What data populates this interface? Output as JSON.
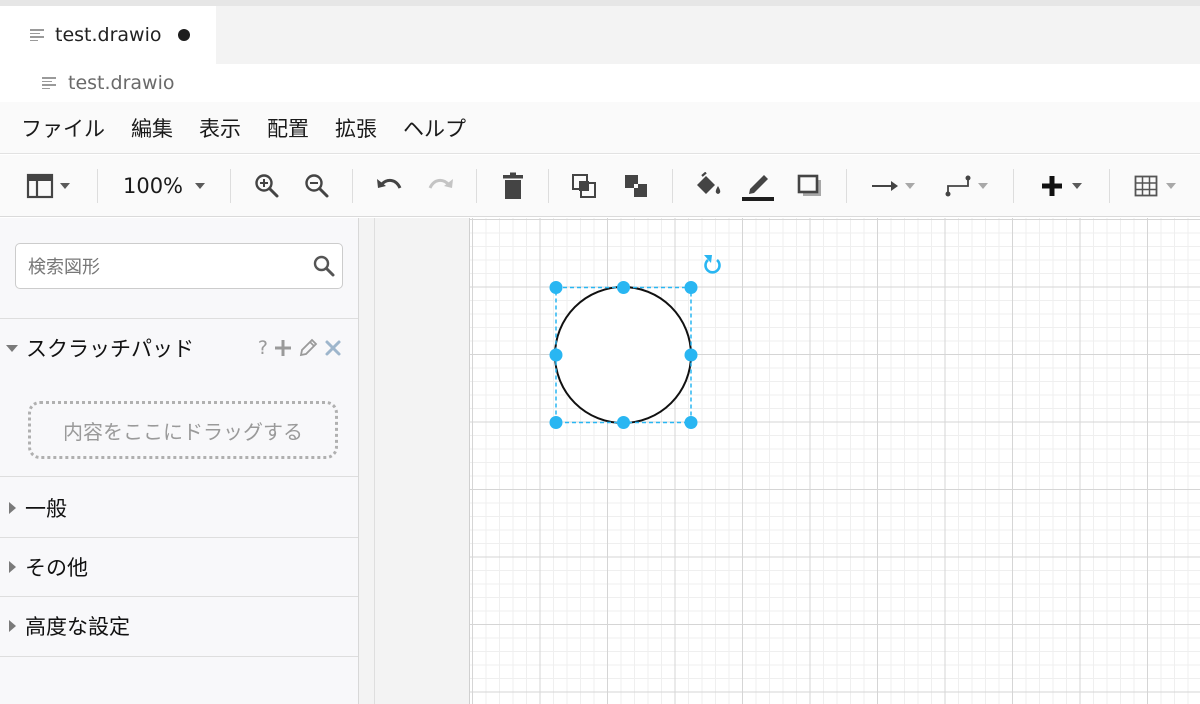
{
  "tab": {
    "title": "test.drawio",
    "icon": "file-lines-icon",
    "unsaved": true
  },
  "breadcrumb": {
    "file": "test.drawio"
  },
  "menu": {
    "items": [
      "ファイル",
      "編集",
      "表示",
      "配置",
      "拡張",
      "ヘルプ"
    ]
  },
  "toolbar": {
    "zoom": "100%",
    "icons": [
      "format-panel-icon",
      "zoom-in-icon",
      "zoom-out-icon",
      "undo-icon",
      "redo-icon",
      "delete-icon",
      "to-front-icon",
      "to-back-icon",
      "fill-color-icon",
      "line-color-icon",
      "shadow-icon",
      "connection-icon",
      "waypoints-icon",
      "insert-plus-icon",
      "table-icon"
    ]
  },
  "sidebar": {
    "search": {
      "placeholder": "検索図形",
      "value": ""
    },
    "scratchpad": {
      "title": "スクラッチパッド",
      "help": "?",
      "drop_hint": "内容をここにドラッグする"
    },
    "sections": [
      {
        "title": "一般"
      },
      {
        "title": "その他"
      },
      {
        "title": "高度な設定"
      }
    ]
  },
  "canvas": {
    "selected_shape": "ellipse",
    "selection_color": "#29b6f2"
  },
  "colors": {
    "accent": "#29b6f2",
    "menubar_bg": "#fafafa",
    "sidebar_bg": "#f8f8fa"
  }
}
